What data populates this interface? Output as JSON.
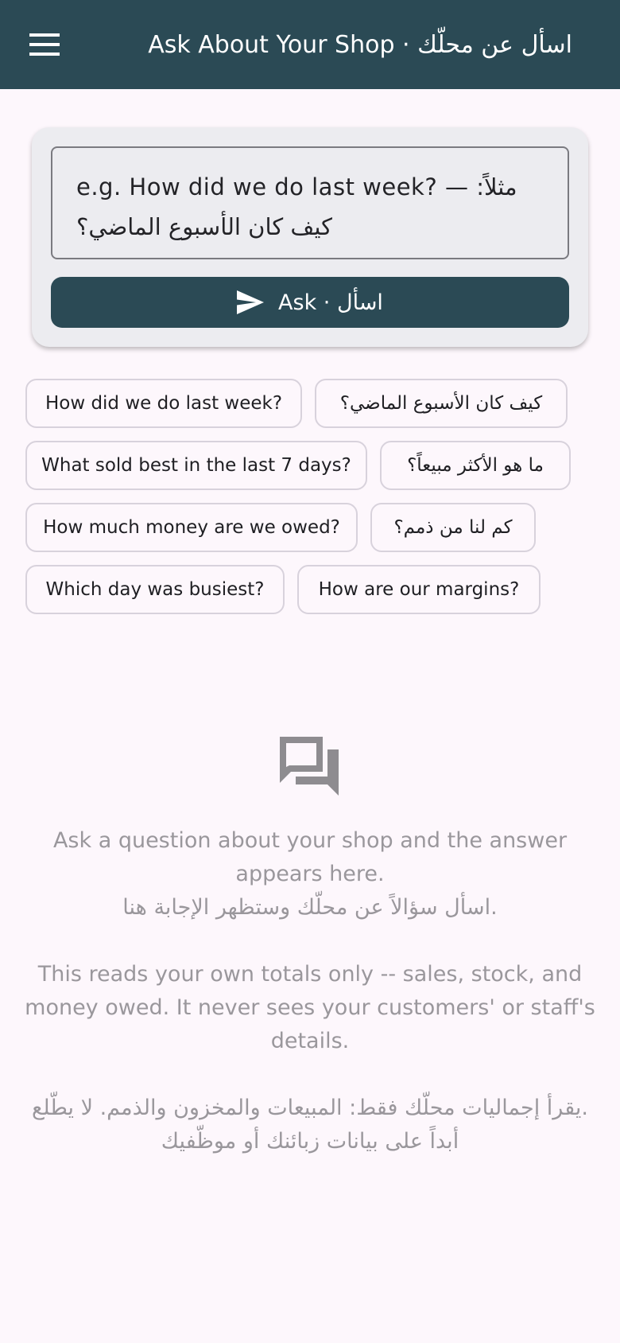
{
  "appbar": {
    "title": "Ask About Your Shop · اسأل عن محلّك",
    "menu_icon": "hamburger-menu-icon"
  },
  "query": {
    "placeholder": "e.g. How did we do last week? — مثلاً: كيف كان الأسبوع الماضي؟",
    "value": ""
  },
  "ask_button": {
    "label": "Ask · اسأل",
    "icon": "send-icon"
  },
  "suggestions": [
    "How did we do last week?",
    "كيف كان الأسبوع الماضي؟",
    "What sold best in the last 7 days?",
    "ما هو الأكثر مبيعاً؟",
    "How much money are we owed?",
    "كم لنا من ذمم؟",
    "Which day was busiest?",
    "How are our margins?"
  ],
  "empty_state": {
    "icon": "question-answer-icon",
    "prompt_en": "Ask a question about your shop and the answer appears here.",
    "prompt_ar": ".اسأل سؤالاً عن محلّك وستظهر الإجابة هنا",
    "privacy_en": "This reads your own totals only -- sales, stock, and money owed. It never sees your customers' or staff's details.",
    "privacy_ar": ".يقرأ إجماليات محلّك فقط: المبيعات والمخزون والذمم. لا يطّلع أبداً على بيانات زبائنك أو موظّفيك"
  },
  "colors": {
    "primary": "#2b4a55",
    "background": "#fdf7fc",
    "card": "#ececf0",
    "muted_text": "#9a979c"
  }
}
